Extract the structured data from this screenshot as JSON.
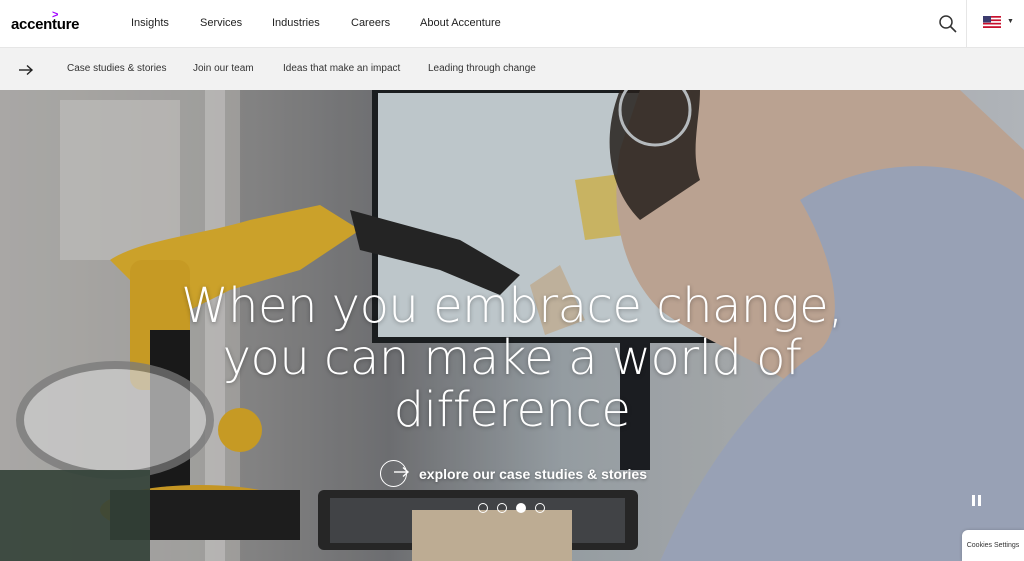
{
  "brand": {
    "logo_text": "accenture",
    "logo_mark": ">",
    "accent_color": "#a100ff"
  },
  "nav": {
    "items": [
      {
        "label": "Insights"
      },
      {
        "label": "Services"
      },
      {
        "label": "Industries"
      },
      {
        "label": "Careers"
      },
      {
        "label": "About Accenture"
      }
    ],
    "search_icon": "search-icon",
    "country_flag": "us-flag-icon"
  },
  "subnav": {
    "arrow_icon": "arrow-right-icon",
    "items": [
      {
        "label": "Case studies & stories"
      },
      {
        "label": "Join our team"
      },
      {
        "label": "Ideas that make an impact"
      },
      {
        "label": "Leading through change"
      }
    ]
  },
  "hero": {
    "title_lines": [
      "When you embrace change,",
      "you can make a world of",
      "difference"
    ],
    "cta_label": "explore our case studies & stories",
    "carousel": {
      "slide_count": 4,
      "active_index": 2
    },
    "pause_icon": "pause-icon"
  },
  "cookies": {
    "label": "Cookies Settings"
  }
}
